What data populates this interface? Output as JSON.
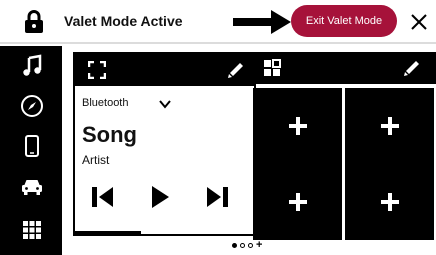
{
  "header": {
    "title": "Valet Mode Active",
    "exit_button_label": "Exit Valet Mode",
    "icons": [
      "lock-icon",
      "arrow-right-icon",
      "close-icon"
    ]
  },
  "colors": {
    "exit_button": "#a6123a",
    "sidebar": "#000000",
    "tiles": "#000000"
  },
  "sidebar": {
    "items": [
      {
        "icon": "music-note-icon"
      },
      {
        "icon": "compass-icon"
      },
      {
        "icon": "phone-icon"
      },
      {
        "icon": "car-icon"
      },
      {
        "icon": "apps-grid-icon"
      }
    ]
  },
  "media_widget": {
    "source": "Bluetooth",
    "song": "Song",
    "artist": "Artist",
    "controls": [
      "previous-track-icon",
      "play-icon",
      "next-track-icon"
    ]
  },
  "grid_widget": {
    "tiles": [
      {
        "icon": "plus-icon"
      },
      {
        "icon": "plus-icon"
      },
      {
        "icon": "plus-icon"
      },
      {
        "icon": "plus-icon"
      }
    ]
  },
  "pager": {
    "pages": 3,
    "current_page": 1,
    "add_symbol": "+"
  }
}
